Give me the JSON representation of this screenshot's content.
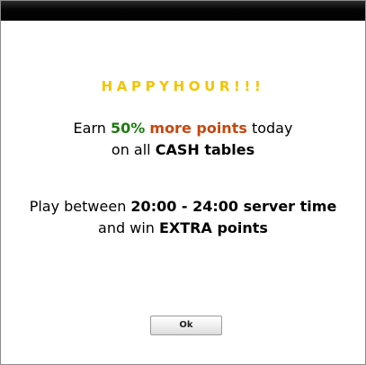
{
  "dialog": {
    "headline": "HAPPYHOUR!!!",
    "promo": {
      "earn": "Earn",
      "percent": "50%",
      "more_points": "more points",
      "today": "today",
      "on_all": "on all",
      "cash_tables": "CASH tables"
    },
    "schedule": {
      "play_between": "Play between",
      "time_range": "20:00 - 24:00 server time",
      "and_win": "and win",
      "extra_points": "EXTRA points"
    },
    "ok_label": "Ok"
  },
  "colors": {
    "headline": "#f5c400",
    "percent": "#1e7a10",
    "more_points": "#c8460d",
    "titlebar": "#000000"
  }
}
